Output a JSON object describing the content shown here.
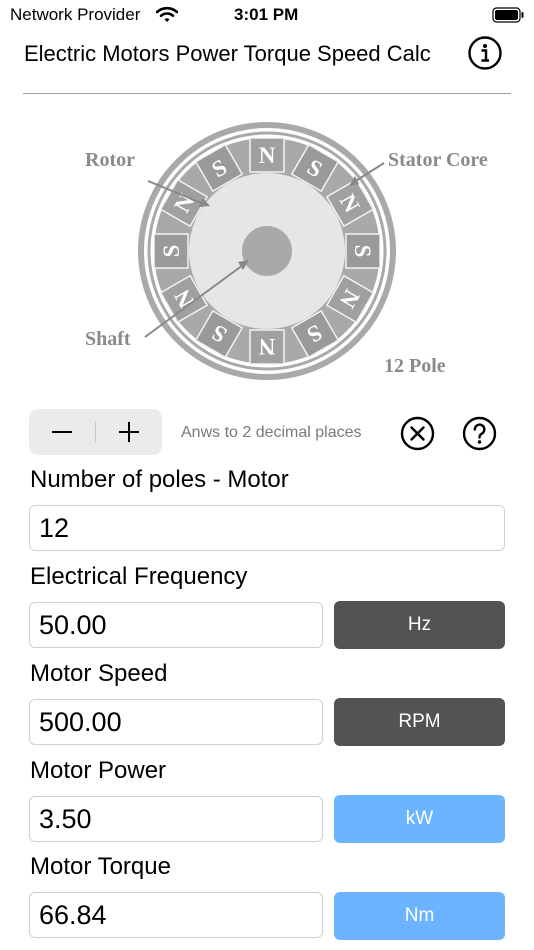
{
  "status_bar": {
    "carrier": "Network Provider",
    "time": "3:01 PM"
  },
  "header": {
    "title": "Electric Motors Power Torque Speed Calc"
  },
  "diagram": {
    "rotor_label": "Rotor",
    "stator_label": "Stator Core",
    "shaft_label": "Shaft",
    "pole_label": "12 Pole",
    "pole_letters": [
      "N",
      "S",
      "N",
      "S",
      "N",
      "S",
      "N",
      "S",
      "N",
      "S",
      "N",
      "S"
    ]
  },
  "controls": {
    "minus_symbol": "−",
    "plus_symbol": "+",
    "decimals_note": "Anws to 2 decimal places"
  },
  "fields": [
    {
      "label": "Number of poles - Motor",
      "value": "12"
    },
    {
      "label": "Electrical Frequency",
      "value": "50.00",
      "unit": "Hz"
    },
    {
      "label": "Motor Speed",
      "value": "500.00",
      "unit": "RPM"
    },
    {
      "label": "Motor Power",
      "value": "3.50",
      "unit": "kW"
    },
    {
      "label": "Motor Torque",
      "value": "66.84",
      "unit": "Nm"
    }
  ],
  "colors": {
    "dark_unit": "#535353",
    "light_unit": "#6cb4ff",
    "diagram_gray": "#a9a9a9"
  }
}
